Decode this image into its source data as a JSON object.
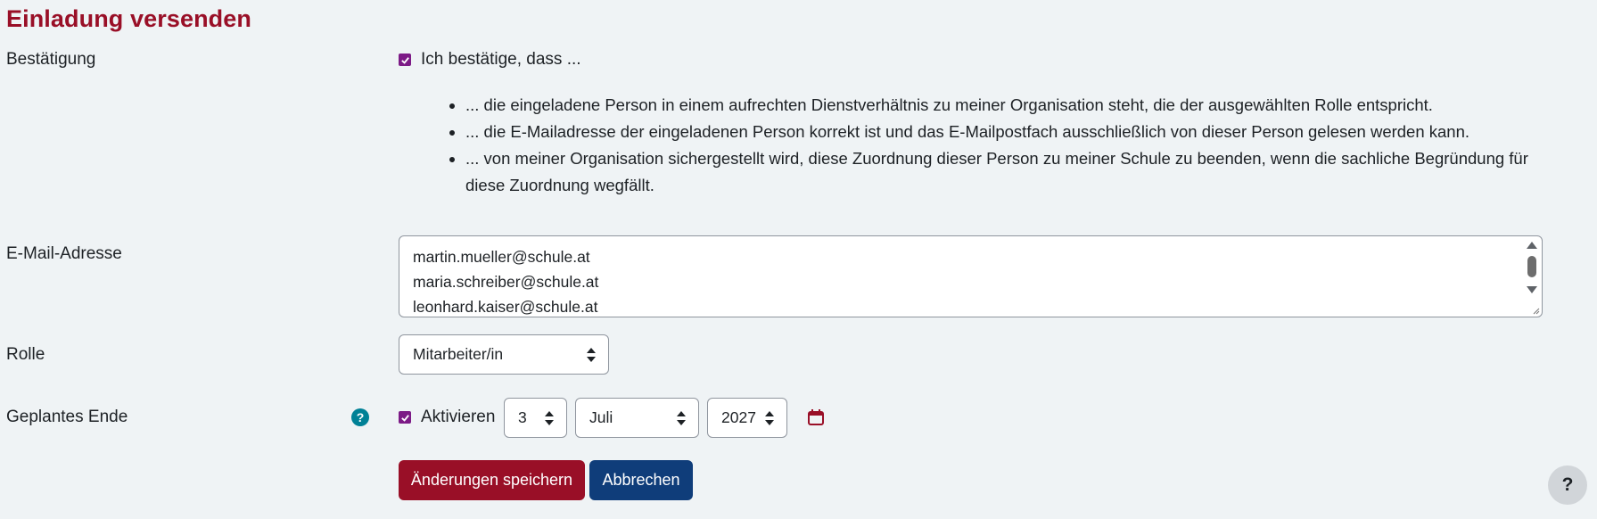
{
  "page": {
    "title": "Einladung versenden"
  },
  "form": {
    "confirmation": {
      "label": "Bestätigung",
      "checkbox_label": "Ich bestätige, dass ...",
      "checked": true,
      "bullets": [
        "... die eingeladene Person in einem aufrechten Dienstverhältnis zu meiner Organisation steht, die der ausgewählten Rolle entspricht.",
        "... die E-Mailadresse der eingeladenen Person korrekt ist und das E-Mailpostfach ausschließlich von dieser Person gelesen werden kann.",
        "... von meiner Organisation sichergestellt wird, diese Zuordnung dieser Person zu meiner Schule zu beenden, wenn die sachliche Begründung für diese Zuordnung wegfällt."
      ]
    },
    "email": {
      "label": "E-Mail-Adresse",
      "lines": [
        "martin.mueller@schule.at",
        "maria.schreiber@schule.at",
        "leonhard.kaiser@schule.at"
      ]
    },
    "role": {
      "label": "Rolle",
      "selected": "Mitarbeiter/in"
    },
    "planned_end": {
      "label": "Geplantes Ende",
      "help_icon": "question-circle-icon",
      "activate_label": "Aktivieren",
      "activate_checked": true,
      "day": "3",
      "month": "Juli",
      "year": "2027",
      "calendar_icon": "calendar-icon"
    }
  },
  "actions": {
    "save_label": "Änderungen speichern",
    "cancel_label": "Abbrechen"
  },
  "floating_help": {
    "label": "?"
  },
  "colors": {
    "brand": "#990f27",
    "secondary": "#0f3d7a",
    "checkbox": "#7c1a86",
    "help": "#008196",
    "background": "#eff3f5"
  }
}
